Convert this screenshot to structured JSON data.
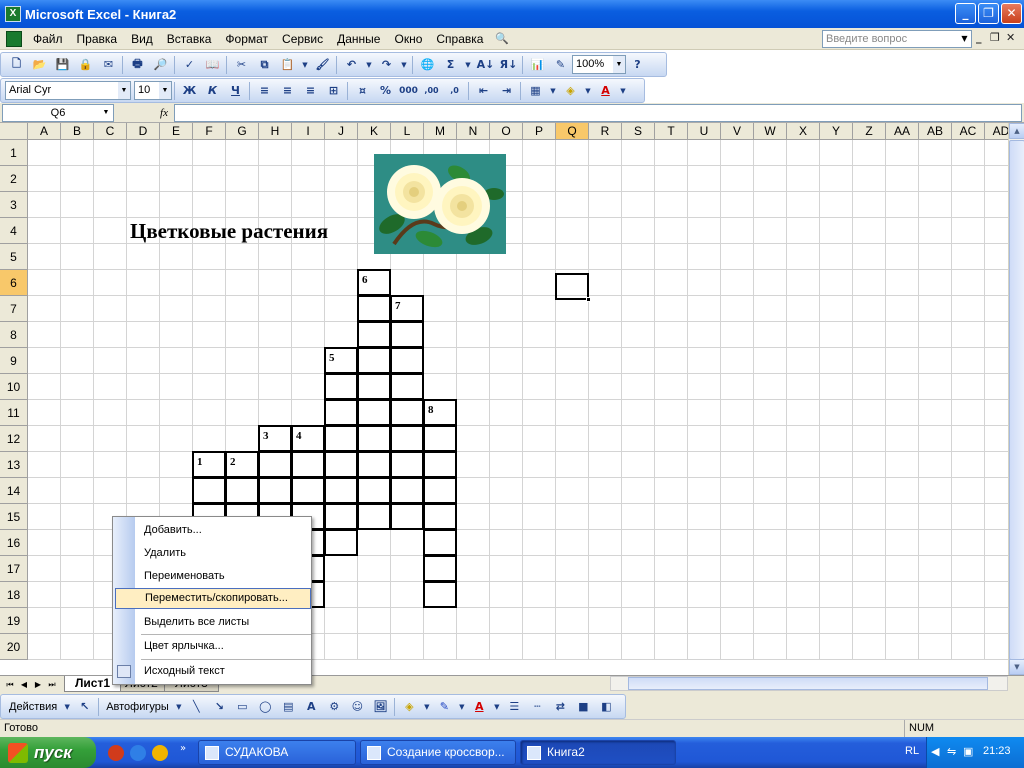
{
  "window": {
    "title": "Microsoft Excel - Книга2",
    "app_icon": "excel-icon",
    "buttons": [
      "minimize-icon",
      "restore-icon",
      "close-icon"
    ]
  },
  "menubar": {
    "items": [
      "Файл",
      "Правка",
      "Вид",
      "Вставка",
      "Формат",
      "Сервис",
      "Данные",
      "Окно",
      "Справка"
    ],
    "ask_placeholder": "Введите вопрос"
  },
  "standard_toolbar": {
    "zoom": "100%"
  },
  "format_toolbar": {
    "font": "Arial Cyr",
    "size": "10",
    "bold": "Ж",
    "italic": "К",
    "underline": "Ч",
    "percent": "%",
    "thousands": "000",
    "increase_decimal": ",00",
    "decrease_decimal": ",0"
  },
  "formula_bar": {
    "name_box": "Q6",
    "fx": "fx",
    "content": ""
  },
  "columns": [
    "A",
    "B",
    "C",
    "D",
    "E",
    "F",
    "G",
    "H",
    "I",
    "J",
    "K",
    "L",
    "M",
    "N",
    "O",
    "P",
    "Q",
    "R",
    "S",
    "T",
    "U",
    "V",
    "W",
    "X",
    "Y",
    "Z",
    "AA",
    "AB",
    "AC",
    "AD"
  ],
  "rows": [
    "1",
    "2",
    "3",
    "4",
    "5",
    "6",
    "7",
    "8",
    "9",
    "10",
    "11",
    "12",
    "13",
    "14",
    "15",
    "16",
    "17",
    "18",
    "19",
    "20"
  ],
  "selected": {
    "column": "Q",
    "row": "6"
  },
  "sheet": {
    "heading": "Цветковые растения",
    "picture": "white-roses-clipart",
    "crossword_numbers": [
      "1",
      "2",
      "3",
      "4",
      "5",
      "6",
      "7",
      "8"
    ]
  },
  "context_menu": {
    "items": [
      {
        "label": "Добавить..."
      },
      {
        "label": "Удалить"
      },
      {
        "label": "Переименовать"
      },
      {
        "label": "Переместить/скопировать..."
      },
      {
        "label": "Выделить все листы"
      },
      {
        "label": "Цвет ярлычка..."
      },
      {
        "label": "Исходный текст"
      }
    ],
    "highlighted_index": 3
  },
  "sheet_tabs": [
    "Лист1",
    "Лист2",
    "Лист3"
  ],
  "active_sheet": "Лист1",
  "drawing_toolbar": {
    "actions": "Действия",
    "autoshapes": "Автофигуры"
  },
  "status": {
    "left": "Готово",
    "num": "NUM"
  },
  "taskbar": {
    "start": "пуск",
    "tasks": [
      {
        "label": "СУДАКОВА"
      },
      {
        "label": "Создание кроссвор..."
      },
      {
        "label": "Книга2"
      }
    ],
    "language": "RL",
    "clock": "21:23"
  }
}
